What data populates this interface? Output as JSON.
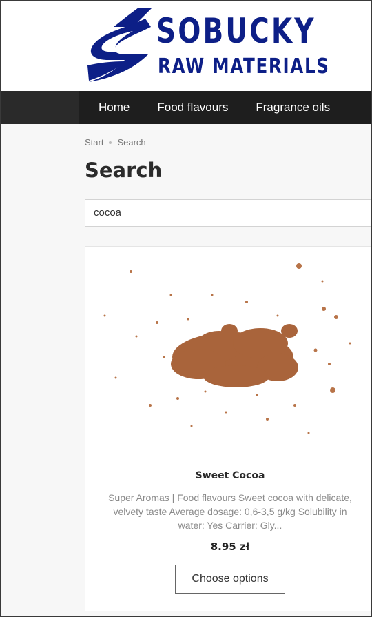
{
  "brand": {
    "name": "SOBUCKY",
    "tagline": "RAW MATERIALS",
    "color": "#0d1f87"
  },
  "nav": {
    "items": [
      {
        "label": "Home"
      },
      {
        "label": "Food flavours"
      },
      {
        "label": "Fragrance oils"
      }
    ]
  },
  "breadcrumb": {
    "start": "Start",
    "current": "Search"
  },
  "page": {
    "title": "Search"
  },
  "search": {
    "value": "cocoa"
  },
  "product": {
    "title": "Sweet Cocoa",
    "description": "Super Aromas | Food flavours Sweet cocoa with delicate, velvety taste Average dosage: 0,6-3,5 g/kg Solubility in water: Yes Carrier: Gly...",
    "price": "8.95 zł",
    "button_label": "Choose options",
    "image": "cocoa-powder-image"
  }
}
